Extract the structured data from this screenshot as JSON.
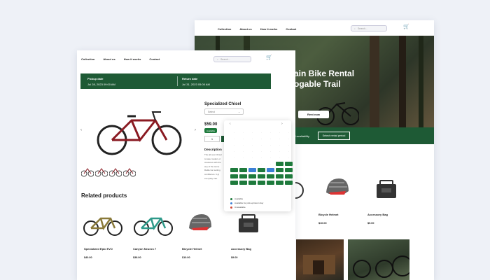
{
  "back_window": {
    "nav": [
      "Collection",
      "About us",
      "How it works",
      "Contact"
    ],
    "search_placeholder": "Search...",
    "cart_count": "0",
    "hero_title_line1": "ain Bike Rental",
    "hero_title_line2": "ogable Trail",
    "hero_button": "Rent now",
    "availability_label": "nd availability",
    "select_period_button": "Select rental period",
    "products": [
      {
        "name": "Bicycle Helmet",
        "price": "$10.00"
      },
      {
        "name": "Accessory Bag",
        "price": "$9.00"
      }
    ]
  },
  "front_window": {
    "nav": [
      "Collection",
      "About us",
      "How it works",
      "Contact"
    ],
    "search_placeholder": "Search...",
    "cart_count": "0",
    "pickup_label": "Pickup date",
    "pickup_value": "Jul 28, 2023 09:00 AM",
    "return_label": "Return date",
    "return_value": "Jul 31, 2023 05:00 AM",
    "product_title": "Specialized Chisel",
    "size_select": "Select",
    "price": "$59.00",
    "availability_badge": "Available",
    "quantity": "1",
    "description_title": "Description",
    "description_lines": [
      "The all-new Chisel",
      "to take modern-d",
      "creatures with the",
      "any of the same",
      "Rattle bar setting",
      "confidence. It gi",
      "everyday trail."
    ],
    "related_title": "Related products",
    "related": [
      {
        "name": "Specialized Epic EVO",
        "price": "$40.00"
      },
      {
        "name": "Canyon Neuron 7",
        "price": "$38.00"
      },
      {
        "name": "Bicycle Helmet",
        "price": "$10.00"
      },
      {
        "name": "Accessory Bag",
        "price": "$9.00"
      }
    ]
  },
  "calendar": {
    "legend": [
      "Available",
      "Available for pick-up/return day",
      "Unavailable"
    ],
    "legend_colors": [
      "#1e7a3c",
      "#3b7fd6",
      "#d14a3a"
    ]
  },
  "colors": {
    "brand_green": "#1e5a35",
    "calendar_green": "#1e7a3c",
    "selected_blue": "#3b7fd6"
  }
}
